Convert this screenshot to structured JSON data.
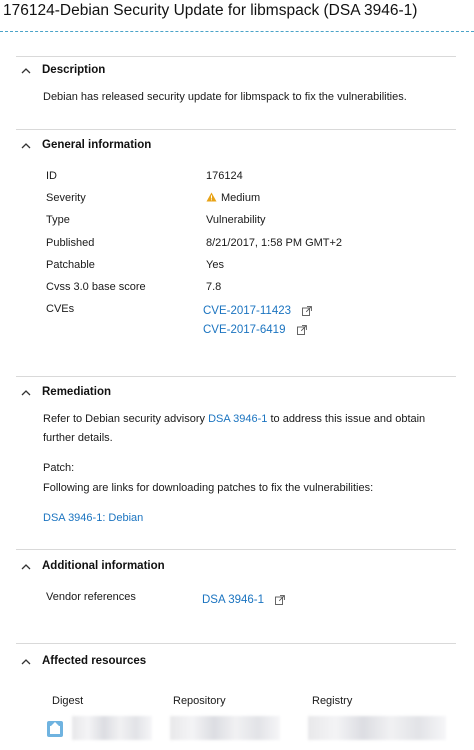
{
  "title": "176124-Debian Security Update for libmspack (DSA 3946-1)",
  "description": {
    "heading": "Description",
    "text": "Debian has released security update for libmspack to fix the vulnerabilities."
  },
  "general": {
    "heading": "General information",
    "rows": [
      {
        "label": "ID",
        "value": "176124"
      },
      {
        "label": "Severity",
        "value": "Medium"
      },
      {
        "label": "Type",
        "value": "Vulnerability"
      },
      {
        "label": "Published",
        "value": "8/21/2017, 1:58 PM GMT+2"
      },
      {
        "label": "Patchable",
        "value": "Yes"
      },
      {
        "label": "Cvss 3.0 base score",
        "value": "7.8"
      },
      {
        "label": "CVEs",
        "value": ""
      }
    ],
    "cves": [
      "CVE-2017-11423",
      "CVE-2017-6419"
    ],
    "severity_color": "#e8a317"
  },
  "remediation": {
    "heading": "Remediation",
    "line1_before": "Refer to Debian security advisory",
    "line1_link": "DSA 3946-1",
    "line1_after": "to address this issue and obtain",
    "line2": "further details.",
    "patch_label": "Patch:",
    "patch_text": "Following are links for downloading patches to fix the vulnerabilities:",
    "patch_link": "DSA 3946-1: Debian"
  },
  "additional": {
    "heading": "Additional information",
    "vendor_label": "Vendor references",
    "vendor_link": "DSA 3946-1"
  },
  "affected": {
    "heading": "Affected resources",
    "columns": [
      "Digest",
      "Repository",
      "Registry"
    ]
  },
  "colors": {
    "link": "#1b74c0",
    "divider": "#d9d9d9",
    "title_divider": "#4aa3c8"
  }
}
